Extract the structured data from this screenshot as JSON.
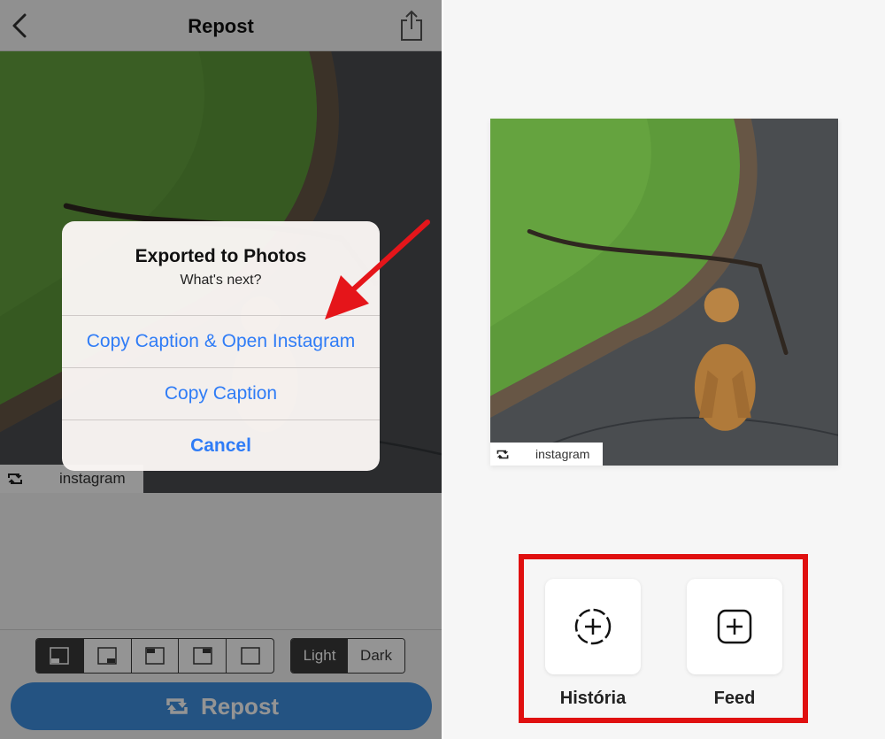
{
  "left": {
    "navbar": {
      "title": "Repost",
      "back_icon": "chevron-left-icon",
      "share_icon": "share-icon"
    },
    "credit": {
      "text": "instagram",
      "icon": "repost-icon"
    },
    "layout_options": [
      "layout-bottom-left",
      "layout-bottom-right",
      "layout-top-left",
      "layout-top-right",
      "layout-none"
    ],
    "theme": {
      "light": "Light",
      "dark": "Dark",
      "selected": "Light"
    },
    "repost_button": {
      "label": "Repost"
    },
    "alert": {
      "title": "Exported to Photos",
      "message": "What's next?",
      "actions": [
        "Copy Caption & Open Instagram",
        "Copy Caption",
        "Cancel"
      ]
    }
  },
  "right": {
    "credit": {
      "text": "instagram",
      "icon": "repost-icon"
    },
    "options": [
      {
        "label": "História",
        "icon": "story-add-icon"
      },
      {
        "label": "Feed",
        "icon": "feed-add-icon"
      }
    ]
  },
  "colors": {
    "accent_blue": "#2f7cf6",
    "repost_button": "#3f8fe0",
    "highlight_red": "#e01010",
    "arrow_red": "#e5151a"
  }
}
